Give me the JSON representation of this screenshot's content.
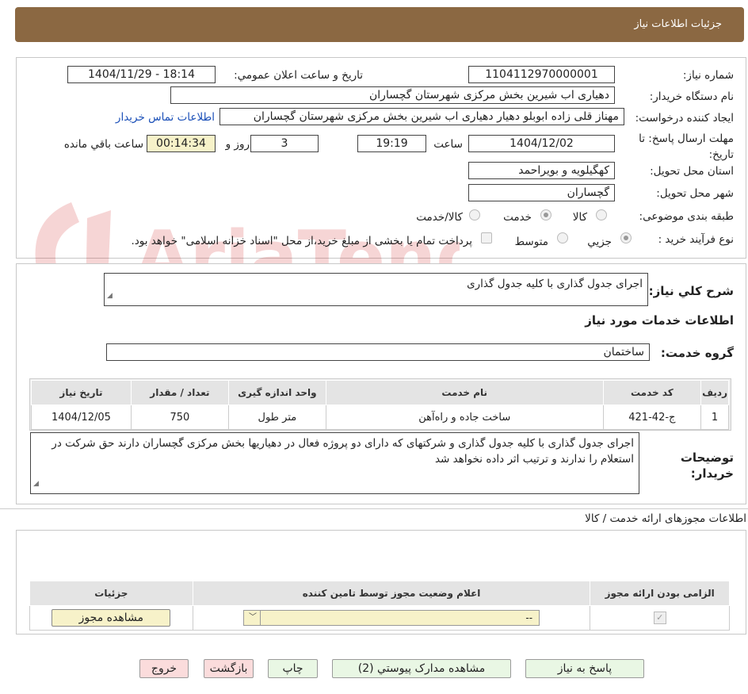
{
  "header": {
    "title": "جزئیات اطلاعات نیاز"
  },
  "form": {
    "need_number_label": "شماره نیاز:",
    "need_number": "1104112970000001",
    "announce_label": "تاریخ و ساعت اعلان عمومي:",
    "announce_value": "1404/11/29 - 18:14",
    "buyer_org_label": "نام دستگاه خریدار:",
    "buyer_org": "دهیاری اب شیرین بخش مرکزی شهرستان گچساران",
    "requester_label": "ایجاد کننده درخواست:",
    "requester": "مهناز قلی زاده ابوبلو دهیار دهیاری اب شیرین بخش مرکزی شهرستان گچساران",
    "contact_link": "اطلاعات تماس خریدار",
    "deadline_label": "مهلت ارسال پاسخ: تا تاریخ:",
    "deadline_date": "1404/12/02",
    "time_label": "ساعت",
    "deadline_time": "19:19",
    "days_value": "3",
    "days_label": "روز و",
    "remaining_time": "00:14:34",
    "remaining_label": "ساعت باقي مانده",
    "province_label": "استان محل تحویل:",
    "province": "کهگیلویه و بویراحمد",
    "city_label": "شهر محل تحویل:",
    "city": "گچساران",
    "category_label": "طبقه بندی موضوعی:",
    "category_options": [
      "کالا",
      "خدمت",
      "کالا/خدمت"
    ],
    "category_selected": "خدمت",
    "process_label": "نوع فرآیند خرید :",
    "process_options": [
      "جزیي",
      "متوسط"
    ],
    "process_selected": "جزیي",
    "payment_note": "پرداخت تمام یا بخشی از مبلغ خرید،از محل \"اسناد خزانه اسلامی\" خواهد بود."
  },
  "summary": {
    "label": "شرح کلي نیاز:",
    "text": "اجرای جدول گذاری با کلیه جدول گذاری"
  },
  "services": {
    "section_title": "اطلاعات خدمات مورد نیاز",
    "group_label": "گروه خدمت:",
    "group_value": "ساختمان",
    "columns": [
      "ردیف",
      "کد خدمت",
      "نام خدمت",
      "واحد اندازه گیری",
      "تعداد / مقدار",
      "تاریخ نیاز"
    ],
    "rows": [
      {
        "row": "1",
        "code": "ج-42-421",
        "name": "ساخت جاده و راه‌آهن",
        "unit": "متر طول",
        "qty": "750",
        "date": "1404/12/05"
      }
    ],
    "buyer_notes_label": "توضیحات خریدار:",
    "buyer_notes": "اجرای جدول گذاری با کلیه جدول گذاری و شرکتهای که دارای دو پروژه فعال در دهیاریها بخش مرکزی گچساران دارند حق شرکت در استعلام را ندارند و ترتیب اثر داده نخواهد شد"
  },
  "permits": {
    "section_title": "اطلاعات مجوزهای ارائه خدمت / کالا",
    "columns": [
      "الزامی بودن ارائه مجوز",
      "اعلام وضعیت مجوز توسط تامین کننده",
      "جزئیات"
    ],
    "select_value": "--",
    "view_button": "مشاهده مجوز"
  },
  "actions": {
    "reply": "پاسخ به نیاز",
    "attachments": "مشاهده مدارک پیوستي (2)",
    "print": "چاپ",
    "back": "بازگشت",
    "exit": "خروج"
  },
  "colors": {
    "header_bg": "#8b6842",
    "green_btn": "#e9f7e4",
    "pink_btn": "#fbdcdc",
    "highlight": "#f7f2c9"
  }
}
